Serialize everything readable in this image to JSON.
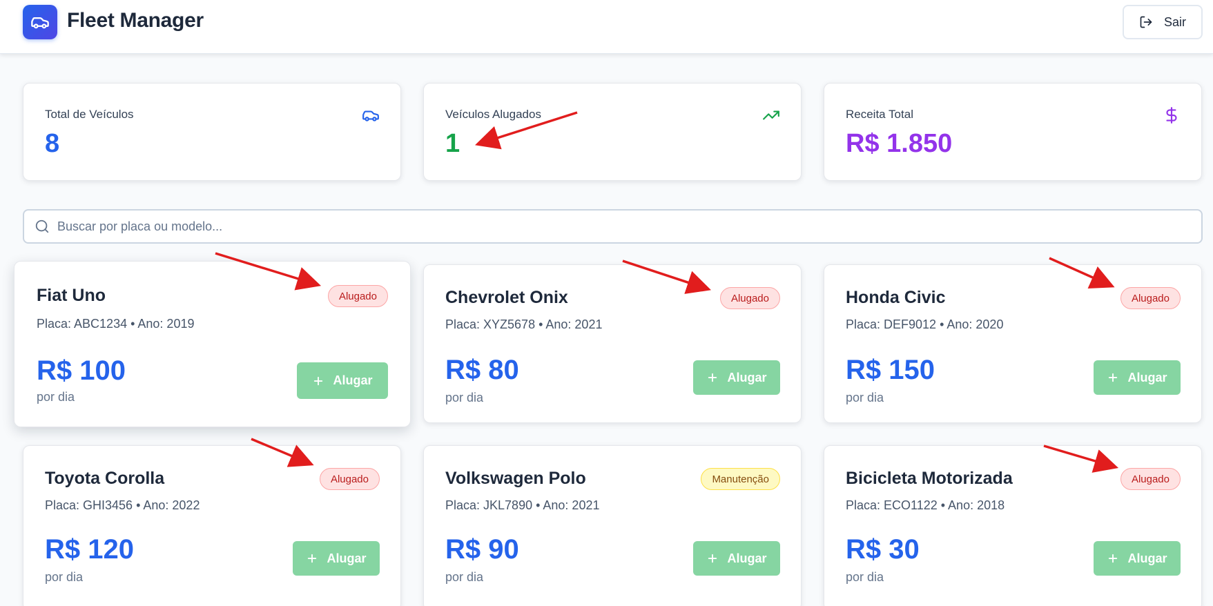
{
  "header": {
    "title": "Fleet Manager",
    "logout_label": "Sair",
    "brand_color": "#2563eb"
  },
  "stats": [
    {
      "label": "Total de Veículos",
      "value": "8",
      "color": "#2563eb",
      "icon": "car-icon"
    },
    {
      "label": "Veículos Alugados",
      "value": "1",
      "color": "#16a34a",
      "icon": "trending-up-icon"
    },
    {
      "label": "Receita Total",
      "value": "R$ 1.850",
      "color": "#9333ea",
      "icon": "dollar-icon"
    }
  ],
  "search": {
    "placeholder": "Buscar por placa ou modelo...",
    "value": ""
  },
  "vehicles": [
    {
      "name": "Fiat Uno",
      "info": "Placa: ABC1234 • Ano: 2019",
      "price": "R$ 100",
      "per": "por dia",
      "status": "Alugado",
      "action": "Alugar"
    },
    {
      "name": "Chevrolet Onix",
      "info": "Placa: XYZ5678 • Ano: 2021",
      "price": "R$ 80",
      "per": "por dia",
      "status": "Alugado",
      "action": "Alugar"
    },
    {
      "name": "Honda Civic",
      "info": "Placa: DEF9012 • Ano: 2020",
      "price": "R$ 150",
      "per": "por dia",
      "status": "Alugado",
      "action": "Alugar"
    },
    {
      "name": "Toyota Corolla",
      "info": "Placa: GHI3456 • Ano: 2022",
      "price": "R$ 120",
      "per": "por dia",
      "status": "Alugado",
      "action": "Alugar"
    },
    {
      "name": "Volkswagen Polo",
      "info": "Placa: JKL7890 • Ano: 2021",
      "price": "R$ 90",
      "per": "por dia",
      "status": "Manutenção",
      "action": "Alugar"
    },
    {
      "name": "Bicicleta Motorizada",
      "info": "Placa: ECO1122 • Ano: 2018",
      "price": "R$ 30",
      "per": "por dia",
      "status": "Alugado",
      "action": "Alugar"
    }
  ],
  "colors": {
    "rented_badge": "#b91c1c",
    "maintenance_badge": "#854d0e",
    "rent_button": "#86d5a2",
    "annotation_arrow": "#e11d1d"
  }
}
